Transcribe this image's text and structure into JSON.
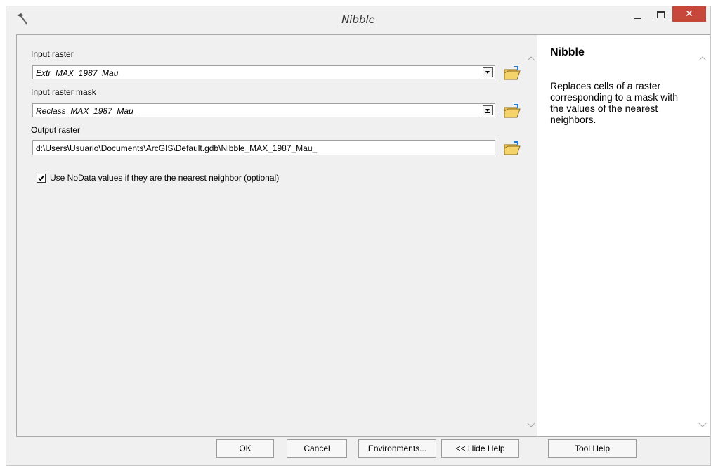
{
  "window": {
    "title": "Nibble",
    "close_label": "✕"
  },
  "form": {
    "input_raster": {
      "label": "Input raster",
      "value": "Extr_MAX_1987_Mau_"
    },
    "input_mask": {
      "label": "Input raster mask",
      "value": "Reclass_MAX_1987_Mau_"
    },
    "output_raster": {
      "label": "Output raster",
      "value": "d:\\Users\\Usuario\\Documents\\ArcGIS\\Default.gdb\\Nibble_MAX_1987_Mau_"
    },
    "nodata_checkbox": {
      "label": "Use NoData values if they are the nearest neighbor (optional)",
      "checked": true
    }
  },
  "help": {
    "title": "Nibble",
    "body": "Replaces cells of a raster corresponding to a mask with the values of the nearest neighbors."
  },
  "buttons": {
    "ok": "OK",
    "cancel": "Cancel",
    "environments": "Environments...",
    "hide_help": "<< Hide Help",
    "tool_help": "Tool Help"
  },
  "icons": {
    "app": "hammer-icon",
    "browse": "open-folder-icon",
    "check": "checkmark-icon"
  },
  "colors": {
    "close_button": "#c7473d",
    "dialog_bg": "#f0f0f0",
    "folder": "#e8c14a"
  }
}
